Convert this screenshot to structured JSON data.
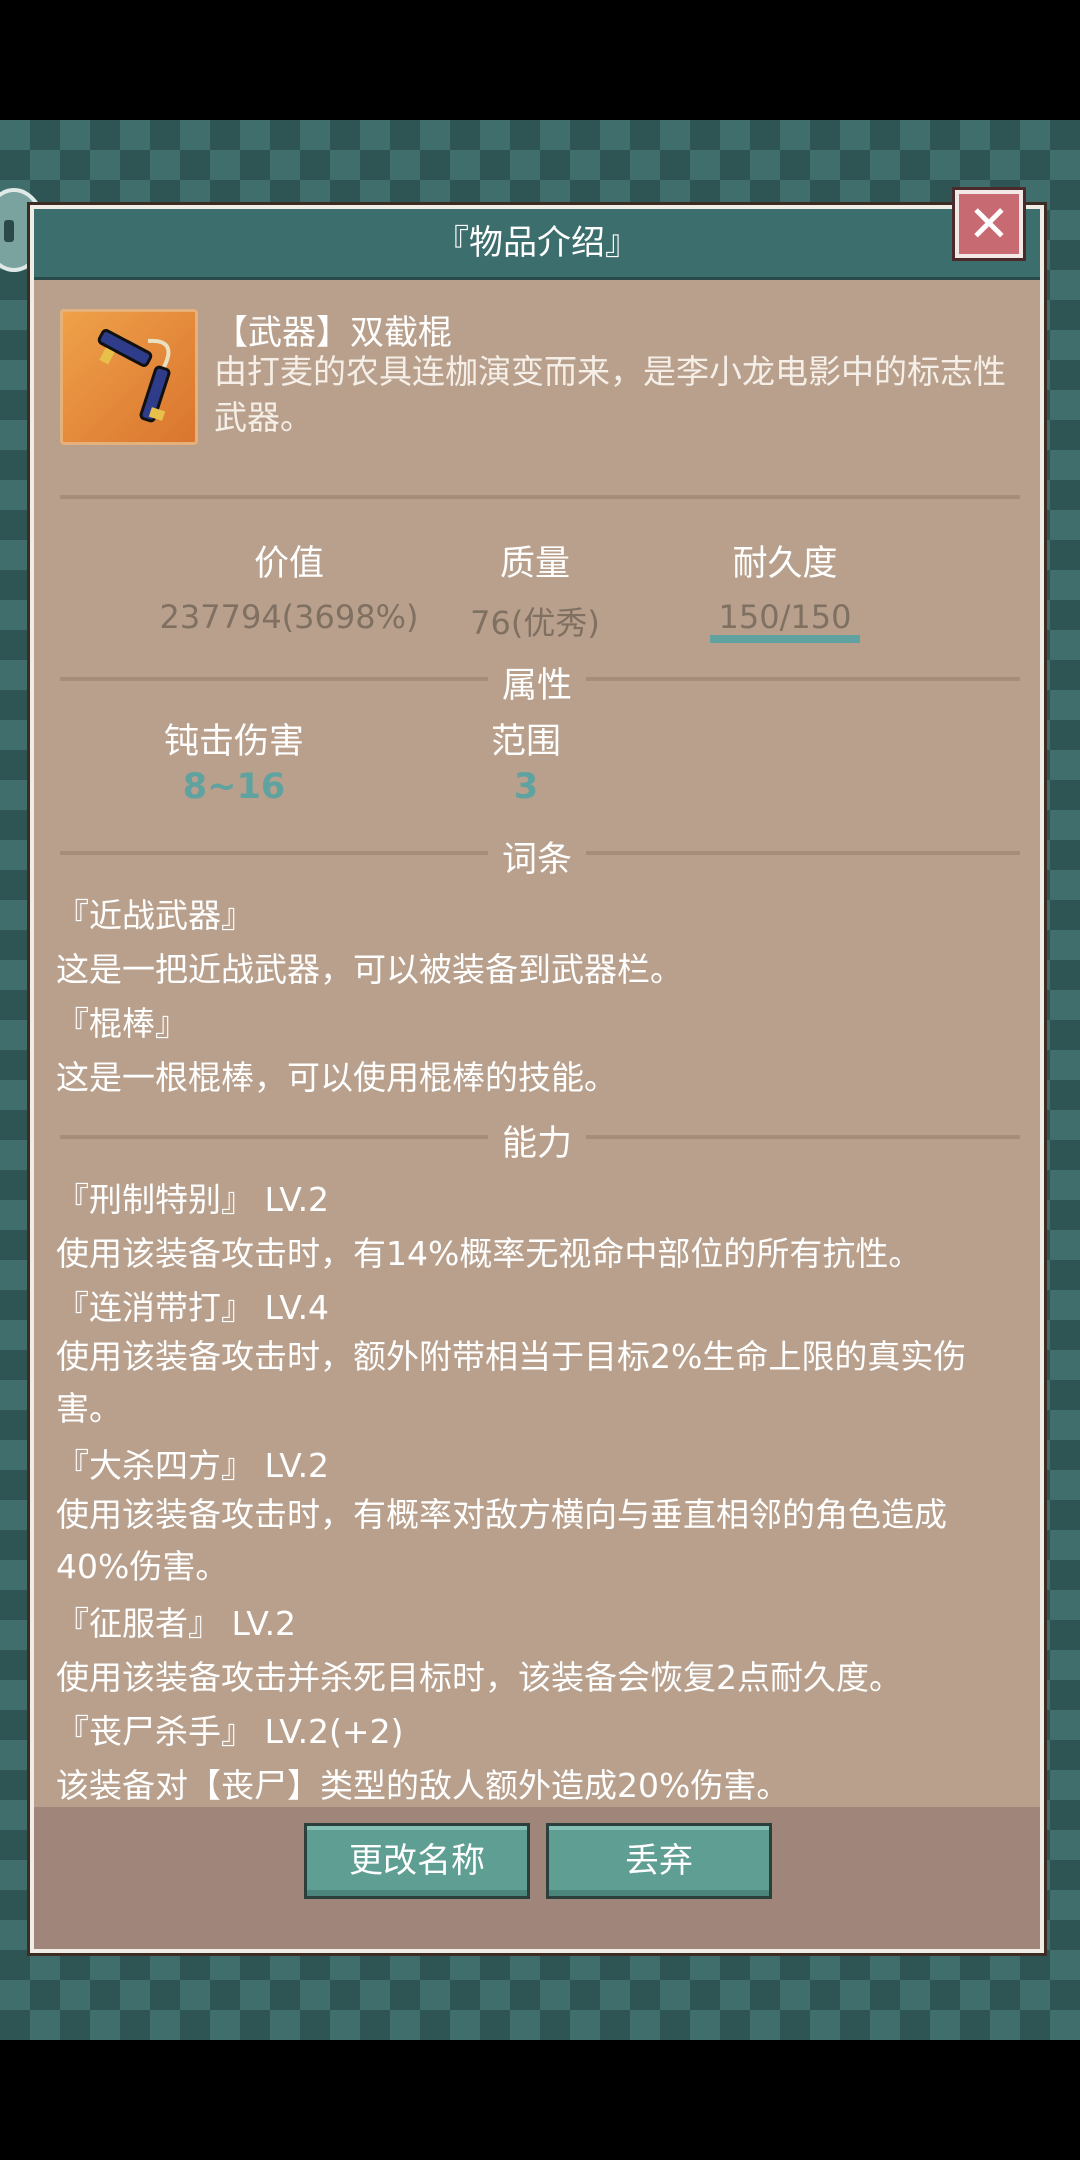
{
  "window": {
    "title": "『物品介绍』",
    "close_symbol": "✕"
  },
  "item": {
    "name": "【武器】双截棍",
    "description": "由打麦的农具连枷演变而来，是李小龙电影中的标志性武器。"
  },
  "stats": [
    {
      "label": "价值",
      "value": "237794(3698%)"
    },
    {
      "label": "质量",
      "value": "76(优秀)"
    },
    {
      "label": "耐久度",
      "value": "150/150",
      "fraction": 1.0
    }
  ],
  "colors": {
    "panel": "#b8a08c",
    "title_bar": "#3c6e6d",
    "accent": "#5fa29f",
    "close": "#c86a72"
  },
  "attributes": {
    "title": "属性",
    "items": [
      {
        "label": "钝击伤害",
        "value": "8~16"
      },
      {
        "label": "范围",
        "value": "3"
      }
    ]
  },
  "traits": {
    "title": "词条",
    "items": [
      {
        "name": "『近战武器』",
        "desc": "这是一把近战武器，可以被装备到武器栏。"
      },
      {
        "name": "『棍棒』",
        "desc": "这是一根棍棒，可以使用棍棒的技能。"
      }
    ]
  },
  "abilities": {
    "title": "能力",
    "items": [
      {
        "name": "『刑制特别』 LV.2",
        "desc": "使用该装备攻击时，有14%概率无视命中部位的所有抗性。"
      },
      {
        "name": "『连消带打』 LV.4",
        "desc": "使用该装备攻击时，额外附带相当于目标2%生命上限的真实伤害。"
      },
      {
        "name": "『大杀四方』 LV.2",
        "desc": "使用该装备攻击时，有概率对敌方横向与垂直相邻的角色造成40%伤害。"
      },
      {
        "name": "『征服者』 LV.2",
        "desc": "使用该装备攻击并杀死目标时，该装备会恢复2点耐久度。"
      },
      {
        "name": "『丧尸杀手』 LV.2(+2)",
        "desc": "该装备对【丧尸】类型的敌人额外造成20%伤害。"
      }
    ]
  },
  "buttons": {
    "rename": "更改名称",
    "discard": "丢弃"
  }
}
